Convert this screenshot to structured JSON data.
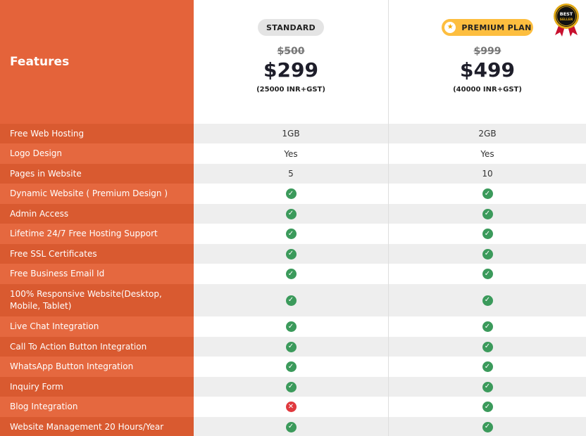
{
  "header": {
    "features_title": "Features",
    "plans": [
      {
        "badge": "STANDARD",
        "old_price": "$500",
        "price": "$299",
        "inr": "(25000 INR+GST)"
      },
      {
        "badge": "PREMIUM PLAN",
        "badge_icon": "star-icon",
        "old_price": "$999",
        "price": "$499",
        "inr": "(40000 INR+GST)"
      }
    ],
    "seal": {
      "icon": "best-seller-seal-icon",
      "line1": "BEST",
      "line2": "SELLER"
    }
  },
  "colors": {
    "accent": "#e4633a",
    "accent_dark": "#d95a30",
    "premium_badge": "#fdbe3f",
    "check": "#3b9a5b",
    "cross": "#e0393e"
  },
  "rows": [
    {
      "feature": "Free Web Hosting",
      "standard": "1GB",
      "premium": "2GB"
    },
    {
      "feature": "Logo Design",
      "standard": "Yes",
      "premium": "Yes"
    },
    {
      "feature": "Pages in Website",
      "standard": "5",
      "premium": "10"
    },
    {
      "feature": "Dynamic Website ( Premium Design )",
      "standard": "check",
      "premium": "check"
    },
    {
      "feature": "Admin Access",
      "standard": "check",
      "premium": "check"
    },
    {
      "feature": "Lifetime 24/7 Free Hosting Support",
      "standard": "check",
      "premium": "check"
    },
    {
      "feature": "Free SSL Certificates",
      "standard": "check",
      "premium": "check"
    },
    {
      "feature": "Free Business Email Id",
      "standard": "check",
      "premium": "check"
    },
    {
      "feature": "100% Responsive Website(Desktop, Mobile, Tablet)",
      "standard": "check",
      "premium": "check"
    },
    {
      "feature": "Live Chat Integration",
      "standard": "check",
      "premium": "check"
    },
    {
      "feature": "Call To Action Button Integration",
      "standard": "check",
      "premium": "check"
    },
    {
      "feature": "WhatsApp Button Integration",
      "standard": "check",
      "premium": "check"
    },
    {
      "feature": "Inquiry Form",
      "standard": "check",
      "premium": "check"
    },
    {
      "feature": "Blog Integration",
      "standard": "cross",
      "premium": "check"
    },
    {
      "feature": "Website Management 20 Hours/Year",
      "standard": "check",
      "premium": "check"
    }
  ]
}
